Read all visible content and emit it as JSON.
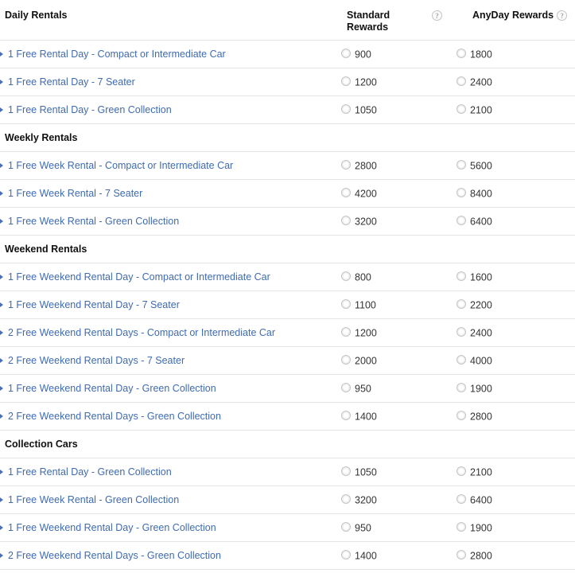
{
  "header": {
    "name_column": "Daily Rentals",
    "standard_column": "Standard Rewards",
    "standard_column_line1": "Standard",
    "standard_column_line2": "Rewards",
    "anyday_column": "AnyDay Rewards",
    "help_icon_glyph": "?",
    "standard_help_tooltip_name": "standard-rewards-help-icon",
    "anyday_help_tooltip_name": "anyday-rewards-help-icon"
  },
  "colors": {
    "link_blue": "#3f6bb0",
    "bullet_blue": "#4a6fb5",
    "header_text": "#111111",
    "row_border": "#e4e4e4",
    "value_text": "#333333",
    "background": "#ffffff"
  },
  "sections": [
    {
      "title": "Daily Rentals",
      "is_first": true,
      "rows": [
        {
          "label": "1 Free Rental Day - Compact or Intermediate Car",
          "standard": "900",
          "anyday": "1800"
        },
        {
          "label": "1 Free Rental Day - 7 Seater",
          "standard": "1200",
          "anyday": "2400"
        },
        {
          "label": "1 Free Rental Day - Green Collection",
          "standard": "1050",
          "anyday": "2100"
        }
      ]
    },
    {
      "title": "Weekly Rentals",
      "is_first": false,
      "rows": [
        {
          "label": "1 Free Week Rental - Compact or Intermediate Car",
          "standard": "2800",
          "anyday": "5600"
        },
        {
          "label": "1 Free Week Rental - 7 Seater",
          "standard": "4200",
          "anyday": "8400"
        },
        {
          "label": "1 Free Week Rental - Green Collection",
          "standard": "3200",
          "anyday": "6400"
        }
      ]
    },
    {
      "title": "Weekend Rentals",
      "is_first": false,
      "rows": [
        {
          "label": "1 Free Weekend Rental Day - Compact or Intermediate Car",
          "standard": "800",
          "anyday": "1600"
        },
        {
          "label": "1 Free Weekend Rental Day - 7 Seater",
          "standard": "1100",
          "anyday": "2200"
        },
        {
          "label": "2 Free Weekend Rental Days - Compact or Intermediate Car",
          "standard": "1200",
          "anyday": "2400"
        },
        {
          "label": "2 Free Weekend Rental Days - 7 Seater",
          "standard": "2000",
          "anyday": "4000"
        },
        {
          "label": "1 Free Weekend Rental Day - Green Collection",
          "standard": "950",
          "anyday": "1900"
        },
        {
          "label": "2 Free Weekend Rental Days - Green Collection",
          "standard": "1400",
          "anyday": "2800"
        }
      ]
    },
    {
      "title": "Collection Cars",
      "is_first": false,
      "rows": [
        {
          "label": "1 Free Rental Day - Green Collection",
          "standard": "1050",
          "anyday": "2100"
        },
        {
          "label": "1 Free Week Rental - Green Collection",
          "standard": "3200",
          "anyday": "6400"
        },
        {
          "label": "1 Free Weekend Rental Day - Green Collection",
          "standard": "950",
          "anyday": "1900"
        },
        {
          "label": "2 Free Weekend Rental Days - Green Collection",
          "standard": "1400",
          "anyday": "2800"
        }
      ]
    }
  ]
}
